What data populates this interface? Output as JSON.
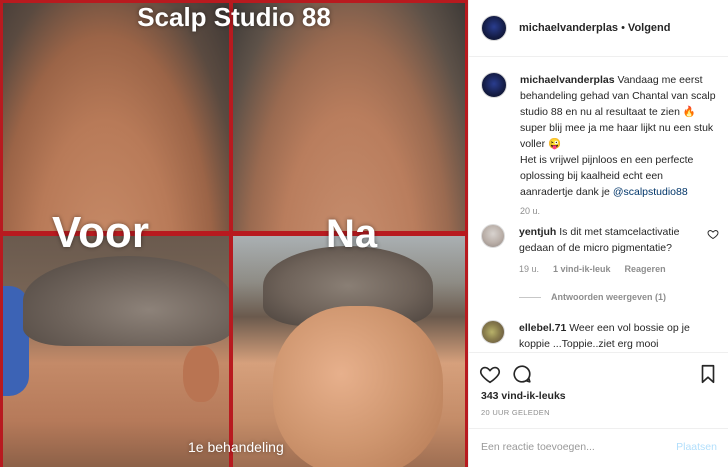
{
  "photo": {
    "title": "Scalp Studio 88",
    "before_label": "Voor",
    "after_label": "Na",
    "treatment_label": "1e behandeling",
    "frame_color": "#b81a1f"
  },
  "header": {
    "username": "michaelvanderplas",
    "separator": "•",
    "follow_status": "Volgend"
  },
  "caption": {
    "username": "michaelvanderplas",
    "text_1": "Vandaag me eerst behandeling gehad van Chantal van scalp studio 88 en nu al resultaat te zien ",
    "flame_emoji": "🔥",
    "text_2": "super blij mee ja me haar lijkt nu een stuk voller ",
    "wink_emoji": "😜",
    "text_3": "Het is vrijwel pijnloos en een perfecte oplossing bij kaalheid echt een aanradertje dank je ",
    "mention": "@scalpstudio88",
    "time": "20 u."
  },
  "comments": [
    {
      "username": "yentjuh",
      "text": "Is dit met stamcelactivatie gedaan of de micro pigmentatie?",
      "time": "19 u.",
      "likes": "1 vind-ik-leuk",
      "reply": "Reageren",
      "view_replies": "Antwoorden weergeven (1)"
    },
    {
      "username": "ellebel.71",
      "text": "Weer een vol bossie op je koppie ...Toppie..ziet erg mooi"
    }
  ],
  "actions": {
    "like_icon": "heart-icon",
    "comment_icon": "speech-bubble-icon",
    "save_icon": "bookmark-icon"
  },
  "likes_count": "343 vind-ik-leuks",
  "time_ago": "20 UUR GELEDEN",
  "add_comment": {
    "placeholder": "Een reactie toevoegen...",
    "post_label": "Plaatsen"
  },
  "colors": {
    "link": "#003569",
    "post_disabled": "#b2dffc",
    "muted": "#8e8e8e"
  }
}
